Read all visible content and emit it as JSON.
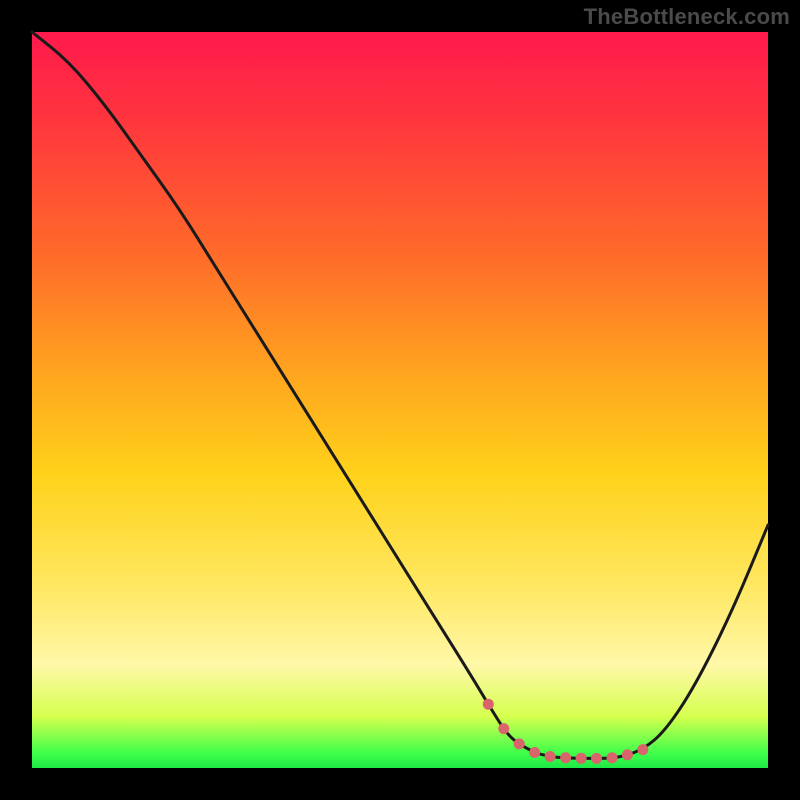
{
  "watermark": "TheBottleneck.com",
  "colors": {
    "background": "#000000",
    "curve_stroke": "#1a1a1a",
    "marker_fill": "#d9646b",
    "gradient_top": "#ff1a4d",
    "gradient_bottom": "#1ee846"
  },
  "chart_data": {
    "type": "line",
    "title": "",
    "xlabel": "",
    "ylabel": "",
    "xlim": [
      0,
      100
    ],
    "ylim": [
      0,
      100
    ],
    "grid": false,
    "legend": false,
    "x": [
      0,
      5,
      10,
      15,
      20,
      25,
      30,
      35,
      40,
      45,
      50,
      55,
      60,
      63,
      65,
      68,
      70,
      72,
      75,
      78,
      80,
      83,
      86,
      90,
      95,
      100
    ],
    "values": [
      100,
      96,
      90,
      83,
      76,
      68,
      60,
      52,
      44,
      36,
      28,
      20,
      12,
      7,
      4,
      2.2,
      1.6,
      1.4,
      1.3,
      1.3,
      1.5,
      2.5,
      5,
      11,
      21,
      33
    ],
    "annotations": [
      {
        "kind": "highlight_segment",
        "color": "#d9646b",
        "x_range": [
          62,
          83
        ],
        "note": "low-bottleneck zone (pink markers along valley)"
      }
    ]
  }
}
